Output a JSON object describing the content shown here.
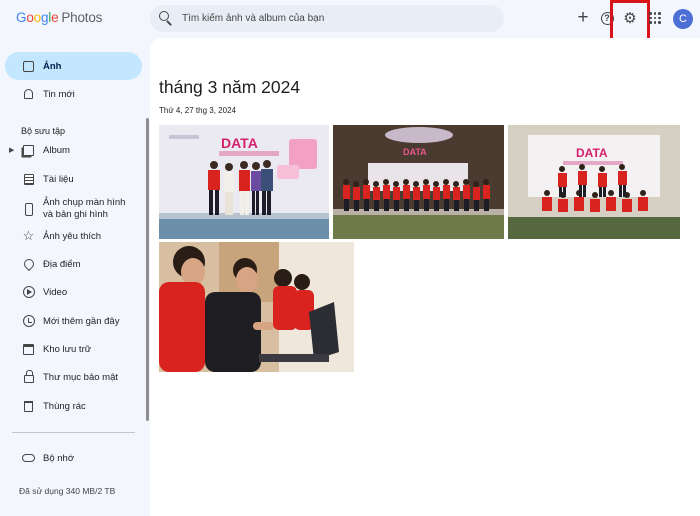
{
  "app": {
    "logo_letters": [
      "G",
      "o",
      "o",
      "g",
      "l",
      "e"
    ],
    "logo_product": "Photos"
  },
  "search": {
    "placeholder": "Tìm kiếm ảnh và album của bạn",
    "icon": "search-icon"
  },
  "toolbar": {
    "create_icon": "plus-icon",
    "help_symbol": "?",
    "help_icon": "help-icon",
    "settings_icon": "gear-icon",
    "settings_symbol": "⚙",
    "apps_icon": "apps-grid-icon",
    "avatar_initial": "C",
    "highlight_color": "#d8141a"
  },
  "sidebar": {
    "primary": [
      {
        "label": "Ảnh",
        "icon": "photo-icon",
        "active": true
      },
      {
        "label": "Tin mới",
        "icon": "bell-icon",
        "active": false
      }
    ],
    "section_title": "Bộ sưu tập",
    "collections": [
      {
        "label": "Album",
        "icon": "album-icon",
        "expandable": true
      },
      {
        "label": "Tài liệu",
        "icon": "document-icon"
      },
      {
        "label": "Ảnh chụp màn hình và bản ghi hình",
        "icon": "phone-screenshot-icon"
      },
      {
        "label": "Ảnh yêu thích",
        "icon": "star-icon"
      },
      {
        "label": "Địa điểm",
        "icon": "location-pin-icon"
      },
      {
        "label": "Video",
        "icon": "play-icon"
      },
      {
        "label": "Mới thêm gần đây",
        "icon": "clock-icon"
      },
      {
        "label": "Kho lưu trữ",
        "icon": "archive-icon"
      },
      {
        "label": "Thư mục bảo mật",
        "icon": "lock-icon"
      },
      {
        "label": "Thùng rác",
        "icon": "trash-icon"
      }
    ],
    "storage_label": "Bộ nhớ",
    "storage_icon": "cloud-icon",
    "storage_used": "Đã sử dụng 340 MB/2 TB",
    "active_color": "#c2e7ff"
  },
  "main": {
    "group_title": "tháng 3 năm 2024",
    "date_label": "Thứ 4, 27 thg 3, 2024",
    "photos": [
      {
        "description": "group-on-stage-data-analytics-backdrop"
      },
      {
        "description": "large-group-photo-hall"
      },
      {
        "description": "group-photo-with-banner"
      },
      {
        "description": "people-at-laptop-workshop"
      }
    ]
  },
  "banner_text": {
    "data": "DATA"
  }
}
